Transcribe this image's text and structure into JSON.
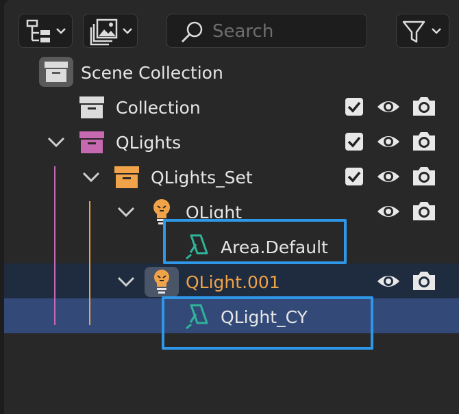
{
  "header": {
    "search_placeholder": "Search",
    "display_mode_icon": "outliner-tree-icon",
    "view_layer_icon": "image-stack-icon",
    "filter_icon": "funnel-icon"
  },
  "tree": {
    "scene_collection": "Scene Collection",
    "rows": [
      {
        "label": "Collection",
        "icon": "collection-box-icon",
        "checked": true,
        "visible": true,
        "renderable": true
      },
      {
        "label": "QLights",
        "icon": "collection-box-icon",
        "checked": true,
        "visible": true,
        "renderable": true
      },
      {
        "label": "QLights_Set",
        "icon": "collection-box-icon",
        "checked": true,
        "visible": true,
        "renderable": true
      },
      {
        "label": "QLight",
        "icon": "light-bulb-icon",
        "visible": true,
        "renderable": true
      },
      {
        "label": "Area.Default",
        "icon": "area-light-icon"
      },
      {
        "label": "QLight.001",
        "icon": "light-bulb-icon",
        "visible": true,
        "renderable": true
      },
      {
        "label": "QLight_CY",
        "icon": "area-light-icon"
      }
    ]
  },
  "colors": {
    "panel_bg": "#282828",
    "selected_row": "#334a78",
    "active_parent_row": "#1f2c3f",
    "active_text": "#f0a348",
    "qlights_collection": "#c769b1",
    "qlights_set_collection": "#f0a348",
    "area_light": "#2fb39a",
    "highlight_box": "#2f97e8"
  }
}
